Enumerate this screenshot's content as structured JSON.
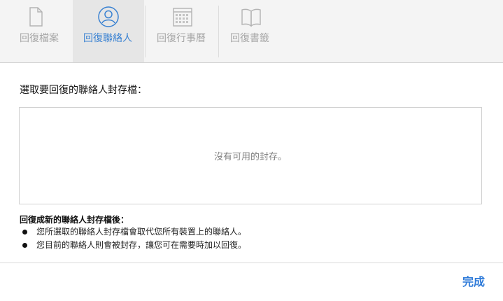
{
  "tabs": [
    {
      "label": "回復檔案",
      "icon": "document-icon"
    },
    {
      "label": "回復聯絡人",
      "icon": "contact-icon",
      "active": true
    },
    {
      "label": "回復行事曆",
      "icon": "calendar-icon"
    },
    {
      "label": "回復書籤",
      "icon": "book-icon"
    }
  ],
  "main": {
    "heading": "選取要回復的聯絡人封存檔：",
    "empty_text": "沒有可用的封存。"
  },
  "notes": {
    "title": "回復成新的聯絡人封存檔後：",
    "items": [
      "您所選取的聯絡人封存檔會取代您所有裝置上的聯絡人。",
      "您目前的聯絡人則會被封存，讓您可在需要時加以回復。"
    ]
  },
  "footer": {
    "done_label": "完成"
  },
  "colors": {
    "accent": "#3a82d2",
    "inactive": "#a6a6a6"
  }
}
